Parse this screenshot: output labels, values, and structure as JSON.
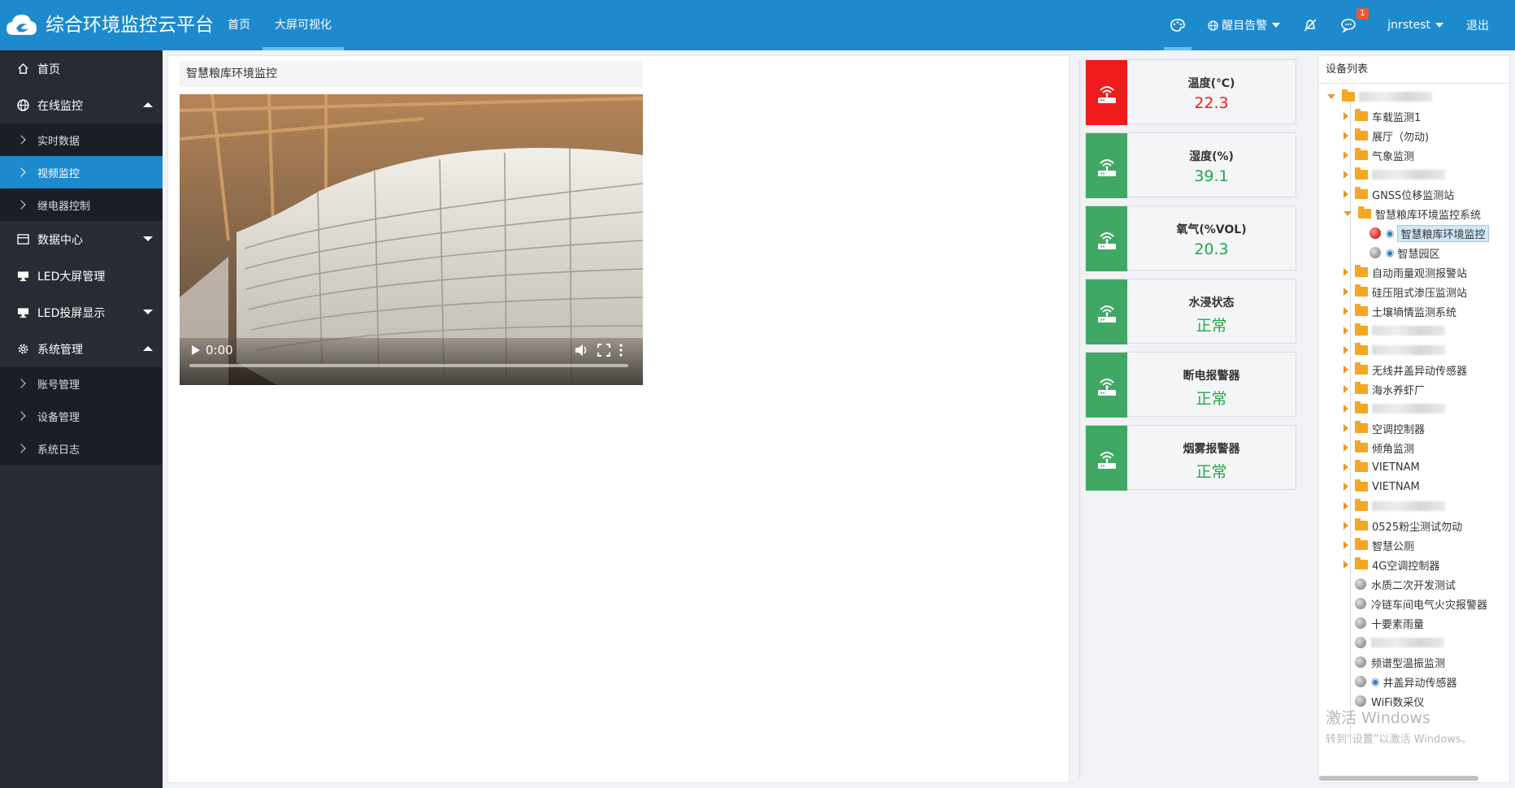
{
  "header": {
    "app_title": "综合环境监控云平台",
    "nav": [
      "首页",
      "大屏可视化"
    ],
    "alarm_label": "醒目告警",
    "badge_count": "1",
    "user": "jnrstest",
    "logout": "退出",
    "colors": {
      "bar": "#1d8ace",
      "active_underline": "#5fc0f2",
      "badge": "#f5562f"
    }
  },
  "sidebar": {
    "items": [
      {
        "label": "首页",
        "icon": "home-icon"
      },
      {
        "label": "在线监控",
        "icon": "globe-icon",
        "expanded": true
      },
      {
        "label": "实时数据",
        "sub": true
      },
      {
        "label": "视频监控",
        "sub": true,
        "active": true
      },
      {
        "label": "继电器控制",
        "sub": true
      },
      {
        "label": "数据中心",
        "icon": "table-icon",
        "expanded": false
      },
      {
        "label": "LED大屏管理",
        "icon": "monitor-icon"
      },
      {
        "label": "LED投屏显示",
        "icon": "monitor-icon",
        "expanded": false
      },
      {
        "label": "系统管理",
        "icon": "gear-icon",
        "expanded": true
      },
      {
        "label": "账号管理",
        "sub": true
      },
      {
        "label": "设备管理",
        "sub": true
      },
      {
        "label": "系统日志",
        "sub": true
      }
    ]
  },
  "video": {
    "title": "智慧粮库环境监控",
    "time": "0:00"
  },
  "cards": [
    {
      "label": "温度(℃)",
      "value": "22.3",
      "status_color": "#ee1c1c",
      "value_color": "#ee1c1c"
    },
    {
      "label": "湿度(%)",
      "value": "39.1",
      "status_color": "#3fa865",
      "value_color": "#20a848"
    },
    {
      "label": "氧气(%VOL)",
      "value": "20.3",
      "status_color": "#3fa865",
      "value_color": "#20a848"
    },
    {
      "label": "水浸状态",
      "value": "正常",
      "status_color": "#3fa865",
      "value_color": "#20a848"
    },
    {
      "label": "断电报警器",
      "value": "正常",
      "status_color": "#3fa865",
      "value_color": "#20a848"
    },
    {
      "label": "烟雾报警器",
      "value": "正常",
      "status_color": "#3fa865",
      "value_color": "#20a848"
    }
  ],
  "device_list": {
    "title": "设备列表",
    "nodes": [
      {
        "label": "",
        "kind": "folder",
        "open": true,
        "blur": true
      },
      {
        "label": "车载监测1",
        "kind": "folder"
      },
      {
        "label": "展厅（勿动)",
        "kind": "folder"
      },
      {
        "label": "气象监测",
        "kind": "folder"
      },
      {
        "label": "",
        "kind": "folder",
        "blur": true
      },
      {
        "label": "GNSS位移监测站",
        "kind": "folder"
      },
      {
        "label": "智慧粮库环境监控系统",
        "kind": "folder",
        "open": true
      },
      {
        "label": "智慧粮库环境监控",
        "kind": "device",
        "status": "alarm",
        "selected": true
      },
      {
        "label": "智慧园区",
        "kind": "device",
        "status": "offline"
      },
      {
        "label": "自动雨量观测报警站",
        "kind": "folder"
      },
      {
        "label": "硅压阻式渗压监测站",
        "kind": "folder"
      },
      {
        "label": "土壤墒情监测系统",
        "kind": "folder"
      },
      {
        "label": "",
        "kind": "folder",
        "blur": true
      },
      {
        "label": "",
        "kind": "folder",
        "blur": true
      },
      {
        "label": "无线井盖异动传感器",
        "kind": "folder"
      },
      {
        "label": "海水养虾厂",
        "kind": "folder"
      },
      {
        "label": "",
        "kind": "folder",
        "blur": true
      },
      {
        "label": "空调控制器",
        "kind": "folder"
      },
      {
        "label": "倾角监测",
        "kind": "folder"
      },
      {
        "label": "VIETNAM",
        "kind": "folder"
      },
      {
        "label": "VIETNAM",
        "kind": "folder"
      },
      {
        "label": "",
        "kind": "folder",
        "blur": true
      },
      {
        "label": "0525粉尘测试勿动",
        "kind": "folder"
      },
      {
        "label": "智慧公厕",
        "kind": "folder"
      },
      {
        "label": "4G空调控制器",
        "kind": "folder"
      },
      {
        "label": "水质二次开发测试",
        "kind": "device",
        "status": "offline"
      },
      {
        "label": "冷链车间电气火灾报警器",
        "kind": "device",
        "status": "offline"
      },
      {
        "label": "十要素雨量",
        "kind": "device",
        "status": "offline"
      },
      {
        "label": "",
        "kind": "device",
        "status": "offline",
        "blur": true
      },
      {
        "label": "频谱型温振监测",
        "kind": "device",
        "status": "offline"
      },
      {
        "label": "井盖异动传感器",
        "kind": "device",
        "status": "offline",
        "signal": true
      },
      {
        "label": "WiFi数采仪",
        "kind": "device",
        "status": "offline"
      }
    ]
  },
  "watermark": {
    "line1": "激活 Windows",
    "line2": "转到“设置”以激活 Windows。"
  }
}
